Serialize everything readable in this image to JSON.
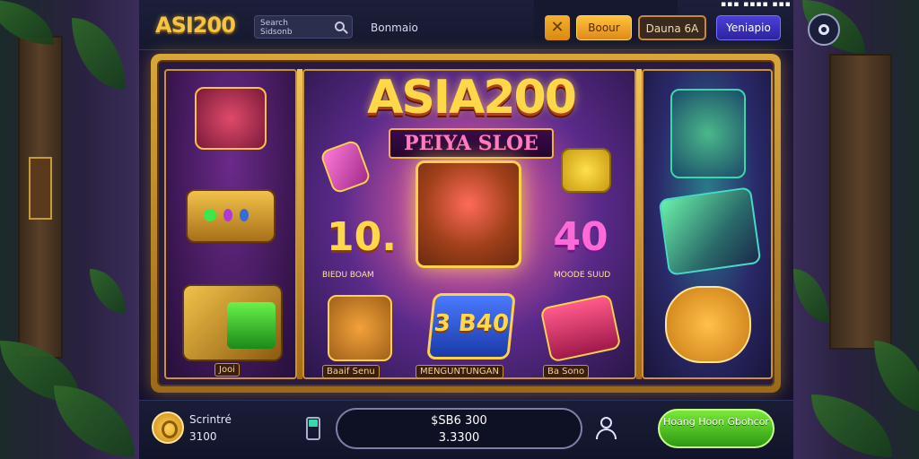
{
  "header": {
    "logo": "ASI200",
    "search_text_line1": "Search",
    "search_text_line2": "Sidsonb",
    "nav_text": "Bonmaio",
    "buttons": {
      "close": "✕",
      "primary": "Boour",
      "secondary": "Dauna 6A",
      "register": "Yeniapio"
    },
    "top_dots": "▪▪▪ ▪▪▪▪ ▪▪▪"
  },
  "game": {
    "title": "ASIA200",
    "subtitle": "PEIYA SLOE",
    "left_label": "Jooi",
    "num_left": "10.",
    "num_left_label": "BIEDU BOAM",
    "num_center": "3 B40",
    "num_center_label": "MENGUNTUNGAN",
    "num_right": "40",
    "num_right_label": "MOODE SUUD",
    "cat_label": "Baaif Senu",
    "scroll_label": "Ba Sono"
  },
  "footer": {
    "credit_label": "Scrintré",
    "credit_value": "3100",
    "amount_top": "$SB6 300",
    "amount_bottom": "3.3300",
    "spin_label": "Hoang Hoon Gbohcor"
  },
  "colors": {
    "gold": "#f4c542",
    "accent_purple": "#4b3fd8",
    "spin_green": "#4cc426"
  }
}
